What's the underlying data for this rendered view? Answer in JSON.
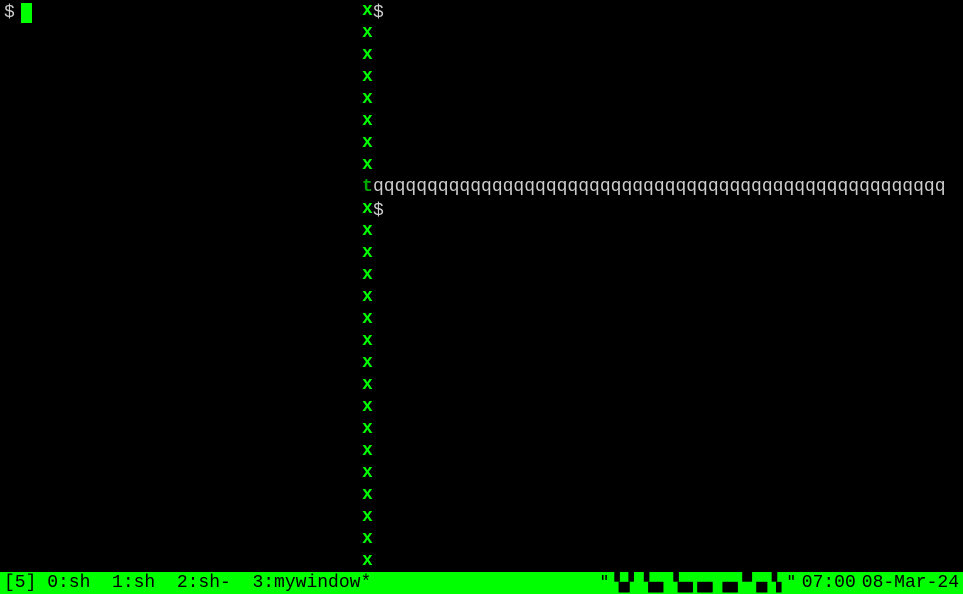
{
  "left_pane": {
    "prompt": "$"
  },
  "right_top": {
    "prompt": "$"
  },
  "right_bottom": {
    "prompt": "$"
  },
  "borders": {
    "vertical_char": "x",
    "tee_char": "t",
    "horizontal_char": "qqqqqqqqqqqqqqqqqqqqqqqqqqqqqqqqqqqqqqqqqqqqqqqqqqqqq"
  },
  "status": {
    "session": "[5]",
    "windows": [
      {
        "index": "0",
        "name": "sh",
        "flag": ""
      },
      {
        "index": "1",
        "name": "sh",
        "flag": ""
      },
      {
        "index": "2",
        "name": "sh",
        "flag": "-"
      },
      {
        "index": "3",
        "name": "mywindow",
        "flag": "*"
      }
    ],
    "host_display": "\"▝▄▘▝▄▖▝▄▖▄▖▗▄▝▘▄▝▖\"",
    "time": "07:00",
    "date": "08-Mar-24"
  }
}
